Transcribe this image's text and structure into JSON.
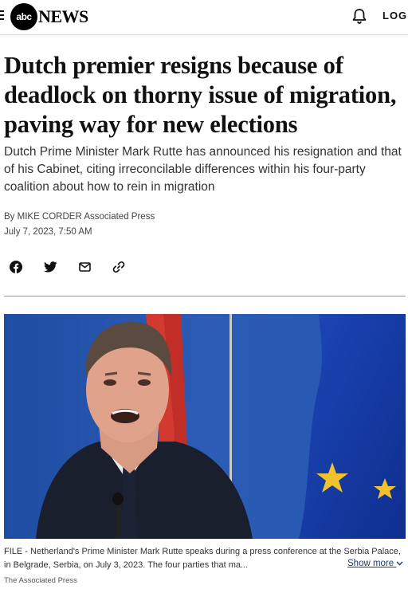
{
  "header": {
    "logo_abc": "abc",
    "logo_news": "NEWS",
    "login_label": "LOG"
  },
  "article": {
    "headline": "Dutch premier resigns because of deadlock on thorny issue of migration, paving way for new elections",
    "dek": "Dutch Prime Minister Mark Rutte has announced his resignation and that of his Cabinet, citing irreconcilable differences within his four-party coalition about how to rein in migration",
    "byline_prefix": "By",
    "author": "MIKE CORDER",
    "outlet": "Associated Press",
    "date": "July 7, 2023, 7:50 AM"
  },
  "share": {
    "icons": [
      "facebook-icon",
      "twitter-icon",
      "email-icon",
      "link-icon"
    ]
  },
  "photo": {
    "caption": "FILE - Netherland's Prime Minister Mark Rutte speaks during a press conference at the Serbia Palace, in Belgrade, Serbia, on July 3, 2023. The four parties that ma...",
    "show_more": "Show more",
    "credit": "The Associated Press"
  }
}
